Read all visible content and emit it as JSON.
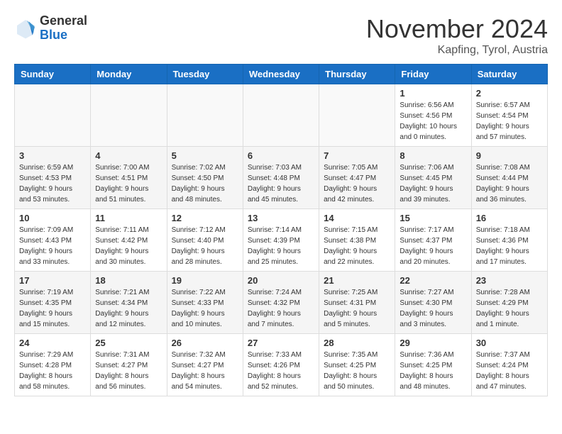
{
  "logo": {
    "general": "General",
    "blue": "Blue"
  },
  "title": "November 2024",
  "location": "Kapfing, Tyrol, Austria",
  "days_of_week": [
    "Sunday",
    "Monday",
    "Tuesday",
    "Wednesday",
    "Thursday",
    "Friday",
    "Saturday"
  ],
  "weeks": [
    [
      {
        "day": "",
        "info": ""
      },
      {
        "day": "",
        "info": ""
      },
      {
        "day": "",
        "info": ""
      },
      {
        "day": "",
        "info": ""
      },
      {
        "day": "",
        "info": ""
      },
      {
        "day": "1",
        "info": "Sunrise: 6:56 AM\nSunset: 4:56 PM\nDaylight: 10 hours and 0 minutes."
      },
      {
        "day": "2",
        "info": "Sunrise: 6:57 AM\nSunset: 4:54 PM\nDaylight: 9 hours and 57 minutes."
      }
    ],
    [
      {
        "day": "3",
        "info": "Sunrise: 6:59 AM\nSunset: 4:53 PM\nDaylight: 9 hours and 53 minutes."
      },
      {
        "day": "4",
        "info": "Sunrise: 7:00 AM\nSunset: 4:51 PM\nDaylight: 9 hours and 51 minutes."
      },
      {
        "day": "5",
        "info": "Sunrise: 7:02 AM\nSunset: 4:50 PM\nDaylight: 9 hours and 48 minutes."
      },
      {
        "day": "6",
        "info": "Sunrise: 7:03 AM\nSunset: 4:48 PM\nDaylight: 9 hours and 45 minutes."
      },
      {
        "day": "7",
        "info": "Sunrise: 7:05 AM\nSunset: 4:47 PM\nDaylight: 9 hours and 42 minutes."
      },
      {
        "day": "8",
        "info": "Sunrise: 7:06 AM\nSunset: 4:45 PM\nDaylight: 9 hours and 39 minutes."
      },
      {
        "day": "9",
        "info": "Sunrise: 7:08 AM\nSunset: 4:44 PM\nDaylight: 9 hours and 36 minutes."
      }
    ],
    [
      {
        "day": "10",
        "info": "Sunrise: 7:09 AM\nSunset: 4:43 PM\nDaylight: 9 hours and 33 minutes."
      },
      {
        "day": "11",
        "info": "Sunrise: 7:11 AM\nSunset: 4:42 PM\nDaylight: 9 hours and 30 minutes."
      },
      {
        "day": "12",
        "info": "Sunrise: 7:12 AM\nSunset: 4:40 PM\nDaylight: 9 hours and 28 minutes."
      },
      {
        "day": "13",
        "info": "Sunrise: 7:14 AM\nSunset: 4:39 PM\nDaylight: 9 hours and 25 minutes."
      },
      {
        "day": "14",
        "info": "Sunrise: 7:15 AM\nSunset: 4:38 PM\nDaylight: 9 hours and 22 minutes."
      },
      {
        "day": "15",
        "info": "Sunrise: 7:17 AM\nSunset: 4:37 PM\nDaylight: 9 hours and 20 minutes."
      },
      {
        "day": "16",
        "info": "Sunrise: 7:18 AM\nSunset: 4:36 PM\nDaylight: 9 hours and 17 minutes."
      }
    ],
    [
      {
        "day": "17",
        "info": "Sunrise: 7:19 AM\nSunset: 4:35 PM\nDaylight: 9 hours and 15 minutes."
      },
      {
        "day": "18",
        "info": "Sunrise: 7:21 AM\nSunset: 4:34 PM\nDaylight: 9 hours and 12 minutes."
      },
      {
        "day": "19",
        "info": "Sunrise: 7:22 AM\nSunset: 4:33 PM\nDaylight: 9 hours and 10 minutes."
      },
      {
        "day": "20",
        "info": "Sunrise: 7:24 AM\nSunset: 4:32 PM\nDaylight: 9 hours and 7 minutes."
      },
      {
        "day": "21",
        "info": "Sunrise: 7:25 AM\nSunset: 4:31 PM\nDaylight: 9 hours and 5 minutes."
      },
      {
        "day": "22",
        "info": "Sunrise: 7:27 AM\nSunset: 4:30 PM\nDaylight: 9 hours and 3 minutes."
      },
      {
        "day": "23",
        "info": "Sunrise: 7:28 AM\nSunset: 4:29 PM\nDaylight: 9 hours and 1 minute."
      }
    ],
    [
      {
        "day": "24",
        "info": "Sunrise: 7:29 AM\nSunset: 4:28 PM\nDaylight: 8 hours and 58 minutes."
      },
      {
        "day": "25",
        "info": "Sunrise: 7:31 AM\nSunset: 4:27 PM\nDaylight: 8 hours and 56 minutes."
      },
      {
        "day": "26",
        "info": "Sunrise: 7:32 AM\nSunset: 4:27 PM\nDaylight: 8 hours and 54 minutes."
      },
      {
        "day": "27",
        "info": "Sunrise: 7:33 AM\nSunset: 4:26 PM\nDaylight: 8 hours and 52 minutes."
      },
      {
        "day": "28",
        "info": "Sunrise: 7:35 AM\nSunset: 4:25 PM\nDaylight: 8 hours and 50 minutes."
      },
      {
        "day": "29",
        "info": "Sunrise: 7:36 AM\nSunset: 4:25 PM\nDaylight: 8 hours and 48 minutes."
      },
      {
        "day": "30",
        "info": "Sunrise: 7:37 AM\nSunset: 4:24 PM\nDaylight: 8 hours and 47 minutes."
      }
    ]
  ]
}
